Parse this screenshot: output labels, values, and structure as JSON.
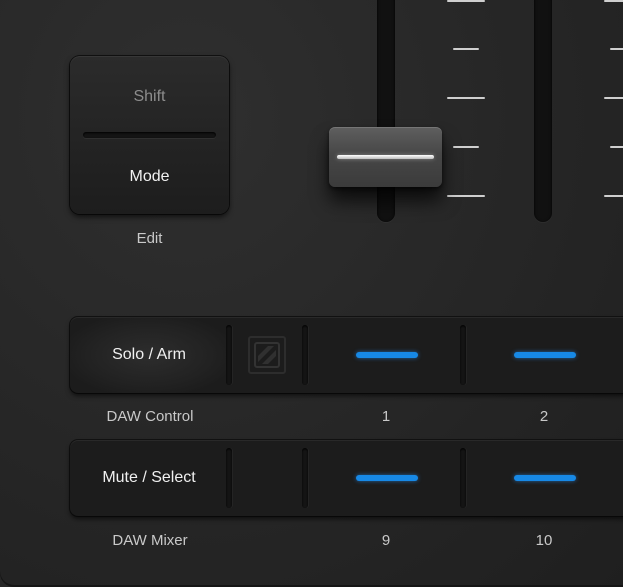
{
  "mode_button": {
    "shift_label": "Shift",
    "mode_label": "Mode",
    "caption": "Edit"
  },
  "fader": {
    "name": "Fader"
  },
  "rows": [
    {
      "button_label": "Solo / Arm",
      "caption": "DAW Control",
      "pad_labels": [
        "1",
        "2"
      ],
      "pad_led_color": "#1789e6"
    },
    {
      "button_label": "Mute / Select",
      "caption": "DAW Mixer",
      "pad_labels": [
        "9",
        "10"
      ],
      "pad_led_color": "#1789e6"
    }
  ],
  "colors": {
    "panel": "#262626",
    "led_blue": "#1789e6",
    "text_primary": "#f2f2f2",
    "text_secondary": "#c9c9c9",
    "text_muted": "#8d8d8d"
  }
}
